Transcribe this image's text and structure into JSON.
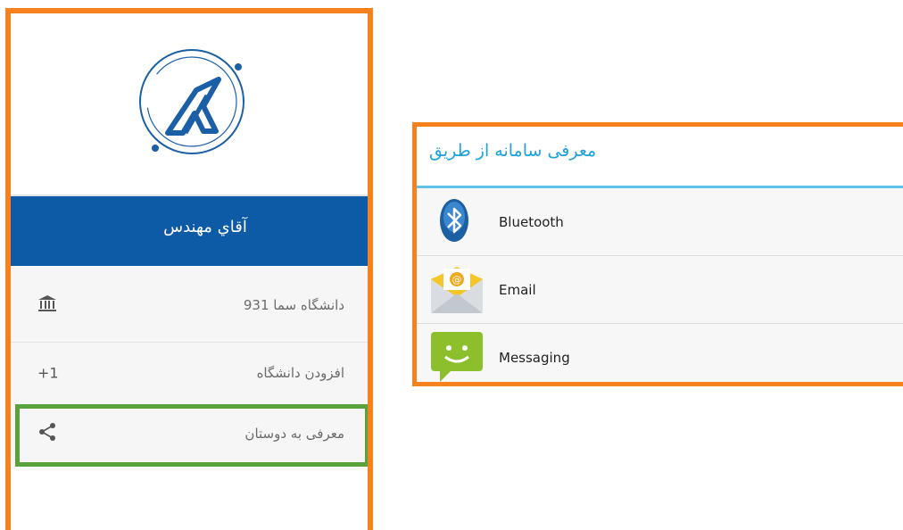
{
  "drawer": {
    "user_name": "آقاي مهندس",
    "items": [
      {
        "label": "دانشگاه سما 931",
        "icon": "bank-icon"
      },
      {
        "label": "افزودن دانشگاه",
        "icon_text": "+1"
      },
      {
        "label": "معرفی به دوستان",
        "icon": "share-icon"
      }
    ]
  },
  "share_dialog": {
    "title": "معرفی سامانه از طریق",
    "options": [
      {
        "label": "Bluetooth",
        "icon": "bluetooth-icon"
      },
      {
        "label": "Email",
        "icon": "email-icon"
      },
      {
        "label": "Messaging",
        "icon": "messaging-icon"
      }
    ]
  },
  "colors": {
    "highlight_orange": "#f5821f",
    "highlight_green": "#5aa33c",
    "header_blue": "#0d5aa7",
    "dialog_title": "#1fa1d8"
  }
}
